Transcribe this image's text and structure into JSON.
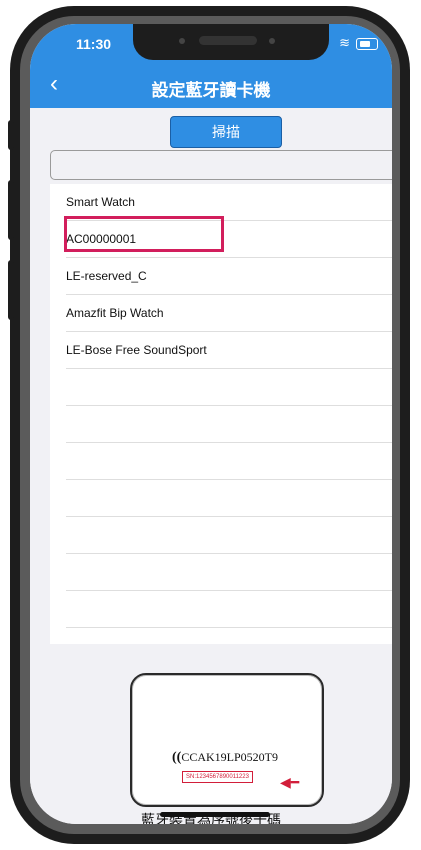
{
  "statusbar": {
    "time": "11:30"
  },
  "navbar": {
    "back_icon": "‹",
    "title": "設定藍牙讀卡機"
  },
  "scan_button": {
    "label": "掃描"
  },
  "devices": [
    {
      "label": "Smart Watch"
    },
    {
      "label": "AC00000001"
    },
    {
      "label": "LE-reserved_C"
    },
    {
      "label": "Amazfit Bip Watch"
    },
    {
      "label": "LE-Bose Free SoundSport"
    }
  ],
  "card": {
    "code": "CCAK19LP0520T9",
    "sn": "SN:1234567890011223"
  },
  "caption": "藍牙裝置為序號後十碼",
  "colors": {
    "accent": "#2f8ee3",
    "highlight": "#d21e5c"
  }
}
